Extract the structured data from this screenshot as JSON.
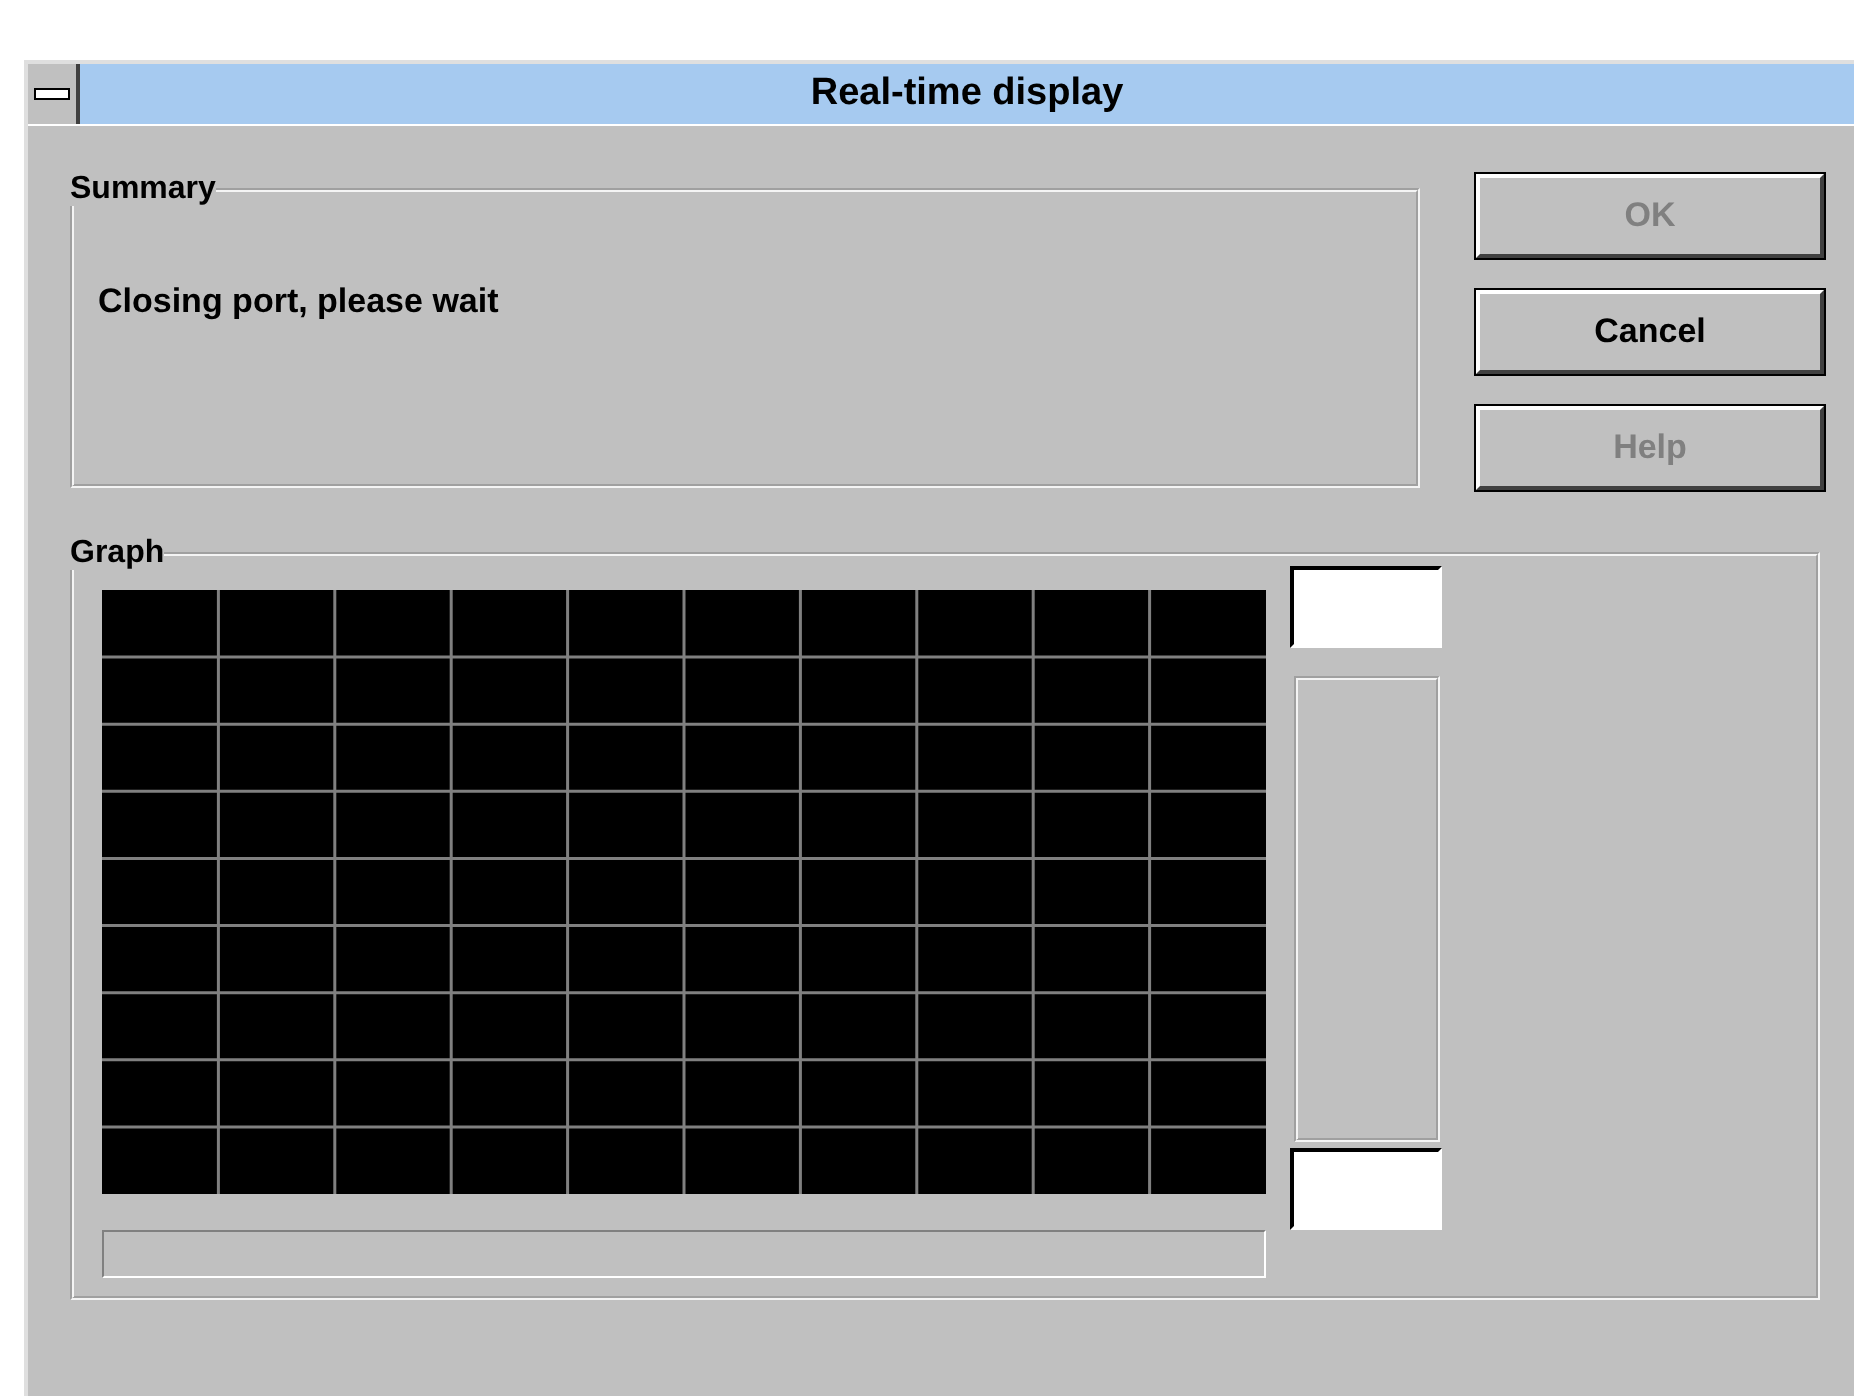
{
  "window": {
    "title": "Real-time display"
  },
  "summary": {
    "title": "Summary",
    "message": "Closing port, please wait"
  },
  "buttons": [
    {
      "label": "OK",
      "disabled": true
    },
    {
      "label": "Cancel",
      "disabled": false
    },
    {
      "label": "Help",
      "disabled": true
    }
  ],
  "graph": {
    "title": "Graph",
    "progress": {
      "level": 0
    }
  }
}
